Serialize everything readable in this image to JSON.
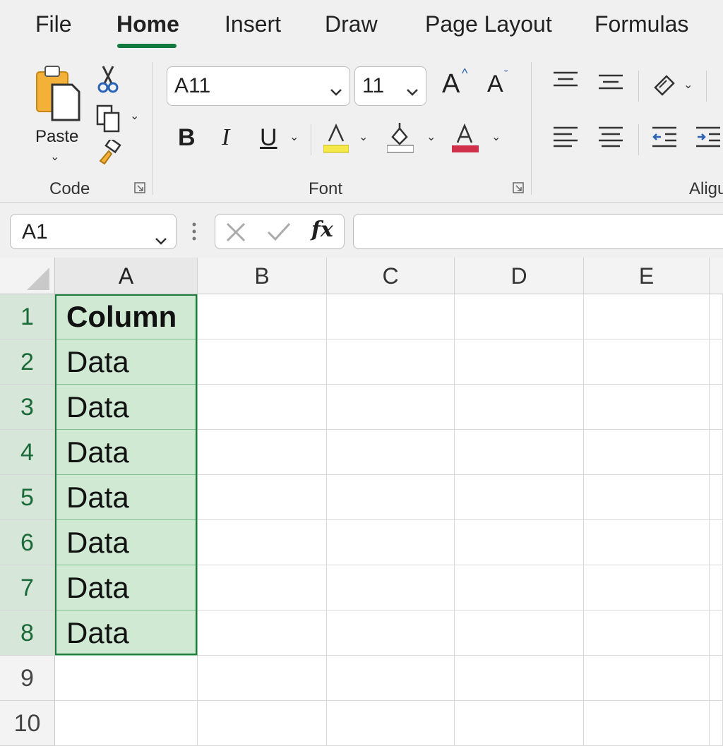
{
  "tabs": [
    {
      "label": "File",
      "active": false
    },
    {
      "label": "Home",
      "active": true
    },
    {
      "label": "Insert",
      "active": false
    },
    {
      "label": "Draw",
      "active": false
    },
    {
      "label": "Page Layout",
      "active": false
    },
    {
      "label": "Formulas",
      "active": false
    }
  ],
  "ribbon": {
    "clipboard": {
      "group_label": "Code",
      "paste_label": "Paste"
    },
    "font": {
      "group_label": "Font",
      "font_name": "A11",
      "font_size": "11",
      "bold": "B",
      "italic": "I",
      "underline": "U",
      "grow": "A",
      "shrink": "A",
      "font_color_glyph": "A",
      "highlight_color": "#f5e84a",
      "fill_color": "#ffffff",
      "font_color": "#d0304a"
    },
    "alignment": {
      "group_label": "Aligu"
    }
  },
  "formula_bar": {
    "name_box": "A1",
    "fx": "fx",
    "formula": ""
  },
  "grid": {
    "columns": [
      "A",
      "B",
      "C",
      "D",
      "E"
    ],
    "rows": [
      "1",
      "2",
      "3",
      "4",
      "5",
      "6",
      "7",
      "8",
      "9",
      "10"
    ],
    "cells_A": [
      "Column",
      "Data",
      "Data",
      "Data",
      "Data",
      "Data",
      "Data",
      "Data",
      "",
      ""
    ],
    "selection_color": "#cfe9d3",
    "accent": "#1e7b3d"
  }
}
